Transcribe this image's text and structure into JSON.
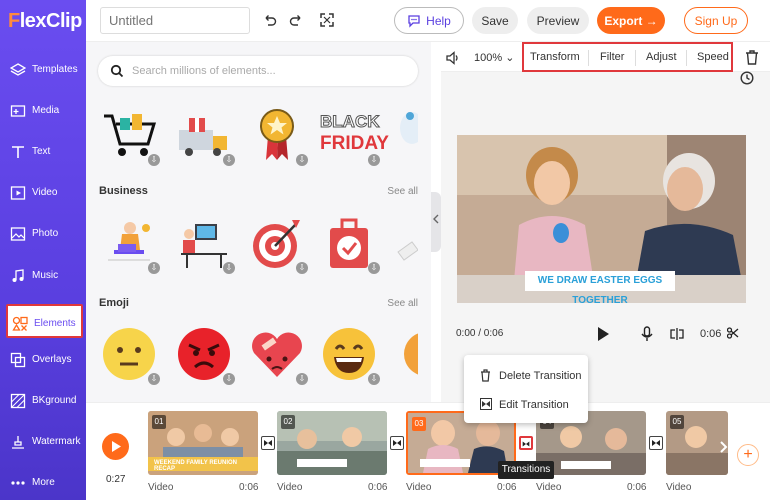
{
  "app": {
    "logo_a": "F",
    "logo_b": "lexClip"
  },
  "sidebar": {
    "items": [
      {
        "label": "Templates",
        "icon": "layers-icon"
      },
      {
        "label": "Media",
        "icon": "media-icon"
      },
      {
        "label": "Text",
        "icon": "text-icon"
      },
      {
        "label": "Video",
        "icon": "video-icon"
      },
      {
        "label": "Photo",
        "icon": "photo-icon"
      },
      {
        "label": "Music",
        "icon": "music-icon"
      },
      {
        "label": "Elements",
        "icon": "elements-icon"
      },
      {
        "label": "Overlays",
        "icon": "overlays-icon"
      },
      {
        "label": "BKground",
        "icon": "background-icon"
      },
      {
        "label": "Watermark",
        "icon": "watermark-icon"
      },
      {
        "label": "More",
        "icon": "more-icon"
      }
    ],
    "active": "Elements"
  },
  "header": {
    "title_placeholder": "Untitled",
    "help_label": "Help",
    "save_label": "Save",
    "preview_label": "Preview",
    "export_label": "Export →",
    "signup_label": "Sign Up"
  },
  "elements_panel": {
    "search_placeholder": "Search millions of elements...",
    "banner_text_top": "BLACK",
    "banner_text_bottom": "FRIDAY",
    "sections": [
      {
        "title": "Business",
        "see_all": "See all"
      },
      {
        "title": "Emoji",
        "see_all": "See all"
      }
    ]
  },
  "preview": {
    "zoom": "100%",
    "tools": [
      "Transform",
      "Filter",
      "Adjust",
      "Speed"
    ],
    "caption": "WE DRAW EASTER EGGS TOGETHER",
    "time_current": "0:00 / 0:06",
    "time_clip": "0:06"
  },
  "timeline": {
    "duration": "0:27",
    "clips": [
      {
        "num": "01",
        "label": "Video",
        "time": "0:06",
        "caption": "WEEKEND FAMILY REUNION RECAP"
      },
      {
        "num": "02",
        "label": "Video",
        "time": "0:06",
        "caption": ""
      },
      {
        "num": "03",
        "label": "Video",
        "time": "0:06",
        "caption": ""
      },
      {
        "num": "04",
        "label": "Video",
        "time": "0:06",
        "caption": ""
      },
      {
        "num": "05",
        "label": "Video",
        "time": "",
        "caption": ""
      }
    ],
    "context_menu": [
      "Delete Transition",
      "Edit Transition"
    ],
    "tooltip": "Transitions"
  },
  "colors": {
    "brand": "#6a4df0",
    "accent": "#ff6a1a",
    "highlight": "#e0383c"
  }
}
